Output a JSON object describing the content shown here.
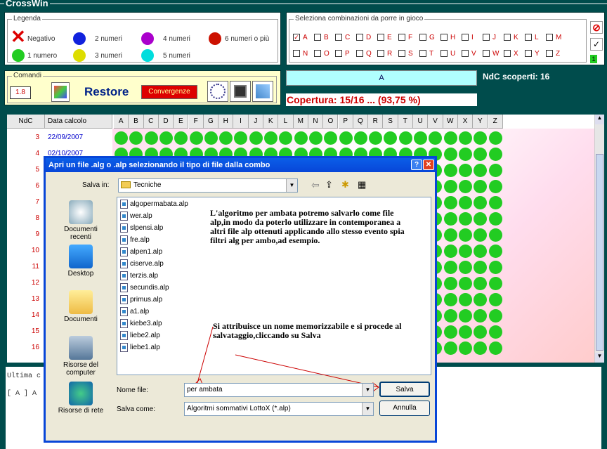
{
  "app": {
    "title": "CrossWin"
  },
  "legend": {
    "title": "Legenda",
    "items": [
      {
        "label": "Negativo",
        "color": "#cc0000",
        "shape": "x"
      },
      {
        "label": "2 numeri",
        "color": "#1122dd",
        "shape": "dot"
      },
      {
        "label": "4 numeri",
        "color": "#aa00cc",
        "shape": "dot"
      },
      {
        "label": "6 numeri o più",
        "color": "#cc1100",
        "shape": "dot"
      },
      {
        "label": "1 numero",
        "color": "#22cc22",
        "shape": "dot"
      },
      {
        "label": "3 numeri",
        "color": "#dddd00",
        "shape": "dot"
      },
      {
        "label": "5 numeri",
        "color": "#00dddd",
        "shape": "dot"
      }
    ]
  },
  "combinations": {
    "title": "Seleziona combinazioni da porre in gioco",
    "row1": [
      "A",
      "B",
      "C",
      "D",
      "E",
      "F",
      "G",
      "H",
      "I",
      "J",
      "K",
      "L",
      "M"
    ],
    "row2": [
      "N",
      "O",
      "P",
      "Q",
      "R",
      "S",
      "T",
      "U",
      "V",
      "W",
      "X",
      "Y",
      "Z"
    ],
    "checked": [
      "A"
    ],
    "side_badge": "1"
  },
  "commands": {
    "title": "Comandi",
    "value": "1.8",
    "restore_label": "Restore",
    "convergenze_label": "Convergenze"
  },
  "status": {
    "selected": "A",
    "ndc_scoperti": "NdC scoperti: 16",
    "copertura": "Copertura: 15/16 ... (93,75 %)"
  },
  "grid": {
    "col_ndc": "NdC",
    "col_data": "Data calcolo",
    "letters": [
      "A",
      "B",
      "C",
      "D",
      "E",
      "F",
      "G",
      "H",
      "I",
      "J",
      "K",
      "L",
      "M",
      "N",
      "O",
      "P",
      "Q",
      "R",
      "S",
      "T",
      "U",
      "V",
      "W",
      "X",
      "Y",
      "Z"
    ],
    "rows": [
      {
        "ndc": "3",
        "date": "22/09/2007"
      },
      {
        "ndc": "4",
        "date": "02/10/2007"
      },
      {
        "ndc": "5",
        "date": ""
      },
      {
        "ndc": "6",
        "date": ""
      },
      {
        "ndc": "7",
        "date": ""
      },
      {
        "ndc": "8",
        "date": ""
      },
      {
        "ndc": "9",
        "date": ""
      },
      {
        "ndc": "10",
        "date": ""
      },
      {
        "ndc": "11",
        "date": ""
      },
      {
        "ndc": "12",
        "date": ""
      },
      {
        "ndc": "13",
        "date": ""
      },
      {
        "ndc": "14",
        "date": ""
      },
      {
        "ndc": "15",
        "date": ""
      },
      {
        "ndc": "16",
        "date": ""
      }
    ]
  },
  "log": {
    "line1": "Ultima c",
    "line2": "[ A ] A"
  },
  "dialog": {
    "title": "Apri un file .alg o .alp selezionando il tipo di file dalla combo",
    "save_in_label": "Salva in:",
    "save_in_value": "Tecniche",
    "places": [
      "Documenti recenti",
      "Desktop",
      "Documenti",
      "Risorse del computer",
      "Risorse di rete"
    ],
    "files": [
      "algopermabata.alp",
      "wer.alp",
      "slpensi.alp",
      "fre.alp",
      "alpen1.alp",
      "ciserve.alp",
      "terzis.alp",
      "secundis.alp",
      "primus.alp",
      "a1.alp",
      "kiebe3.alp",
      "liebe2.alp",
      "liebe1.alp"
    ],
    "note1": "L'algoritmo per ambata potremo salvarlo come file alp,in modo da poterlo utilizzare in contemporanea a altri file alp ottenuti applicando allo stesso evento spia filtri alg per ambo,ad esempio.",
    "note2": "Si attribuisce un nome memorizzabile e si procede al salvataggio,cliccando su Salva",
    "filename_label": "Nome file:",
    "filename_value": "per ambata",
    "type_label": "Salva come:",
    "type_value": "Algoritmi sommativi LottoX (*.alp)",
    "save_label": "Salva",
    "cancel_label": "Annulla"
  }
}
